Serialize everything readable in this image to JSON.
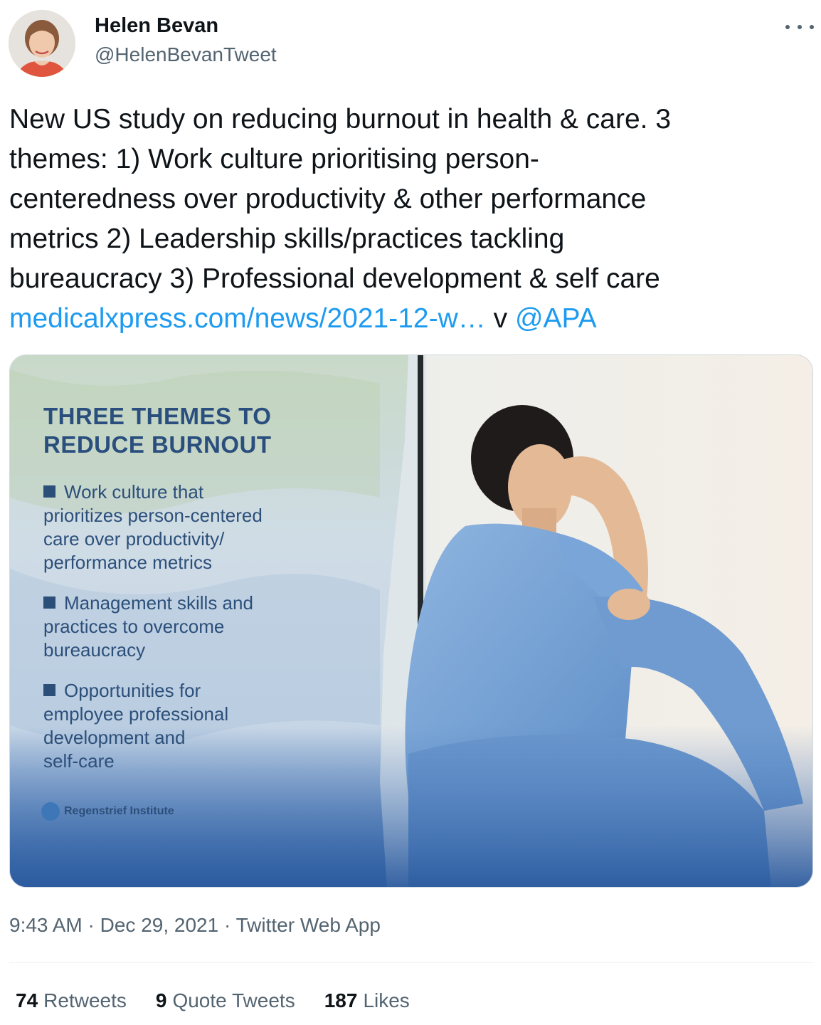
{
  "author": {
    "display_name": "Helen Bevan",
    "handle": "@HelenBevanTweet",
    "avatar_icon": "profile-photo"
  },
  "more_menu_icon": "ellipsis-icon",
  "tweet": {
    "text_lines": [
      "New US study on reducing burnout in health & care. 3",
      "themes: 1) Work culture prioritising person-",
      "centeredness over productivity & other performance",
      "metrics 2) Leadership skills/practices tackling",
      "bureaucracy 3) Professional development & self care"
    ],
    "link_text": "medicalxpress.com/news/2021-12-w…",
    "link_separator": " v ",
    "mention": "@APA"
  },
  "media": {
    "title_line1": "THREE THEMES TO",
    "title_line2": "REDUCE BURNOUT",
    "themes": [
      [
        "Work culture that",
        "prioritizes person-centered",
        "care over productivity/",
        "performance metrics"
      ],
      [
        "Management skills and",
        "practices to overcome",
        "bureaucracy"
      ],
      [
        "Opportunities for",
        "employee professional",
        "development and",
        "self-care"
      ]
    ],
    "institute": "Regenstrief Institute"
  },
  "meta": {
    "time": "9:43 AM",
    "date": "Dec 29, 2021",
    "source": "Twitter Web App",
    "separator": " · "
  },
  "stats": {
    "retweets_count": "74",
    "retweets_label": "Retweets",
    "quotes_count": "9",
    "quotes_label": "Quote Tweets",
    "likes_count": "187",
    "likes_label": "Likes"
  },
  "colors": {
    "link": "#1d9bf0",
    "text_primary": "#0f1419",
    "text_secondary": "#536471",
    "infographic_blue": "#2c4f7a",
    "scrubs_blue": "#7aa5d8"
  }
}
